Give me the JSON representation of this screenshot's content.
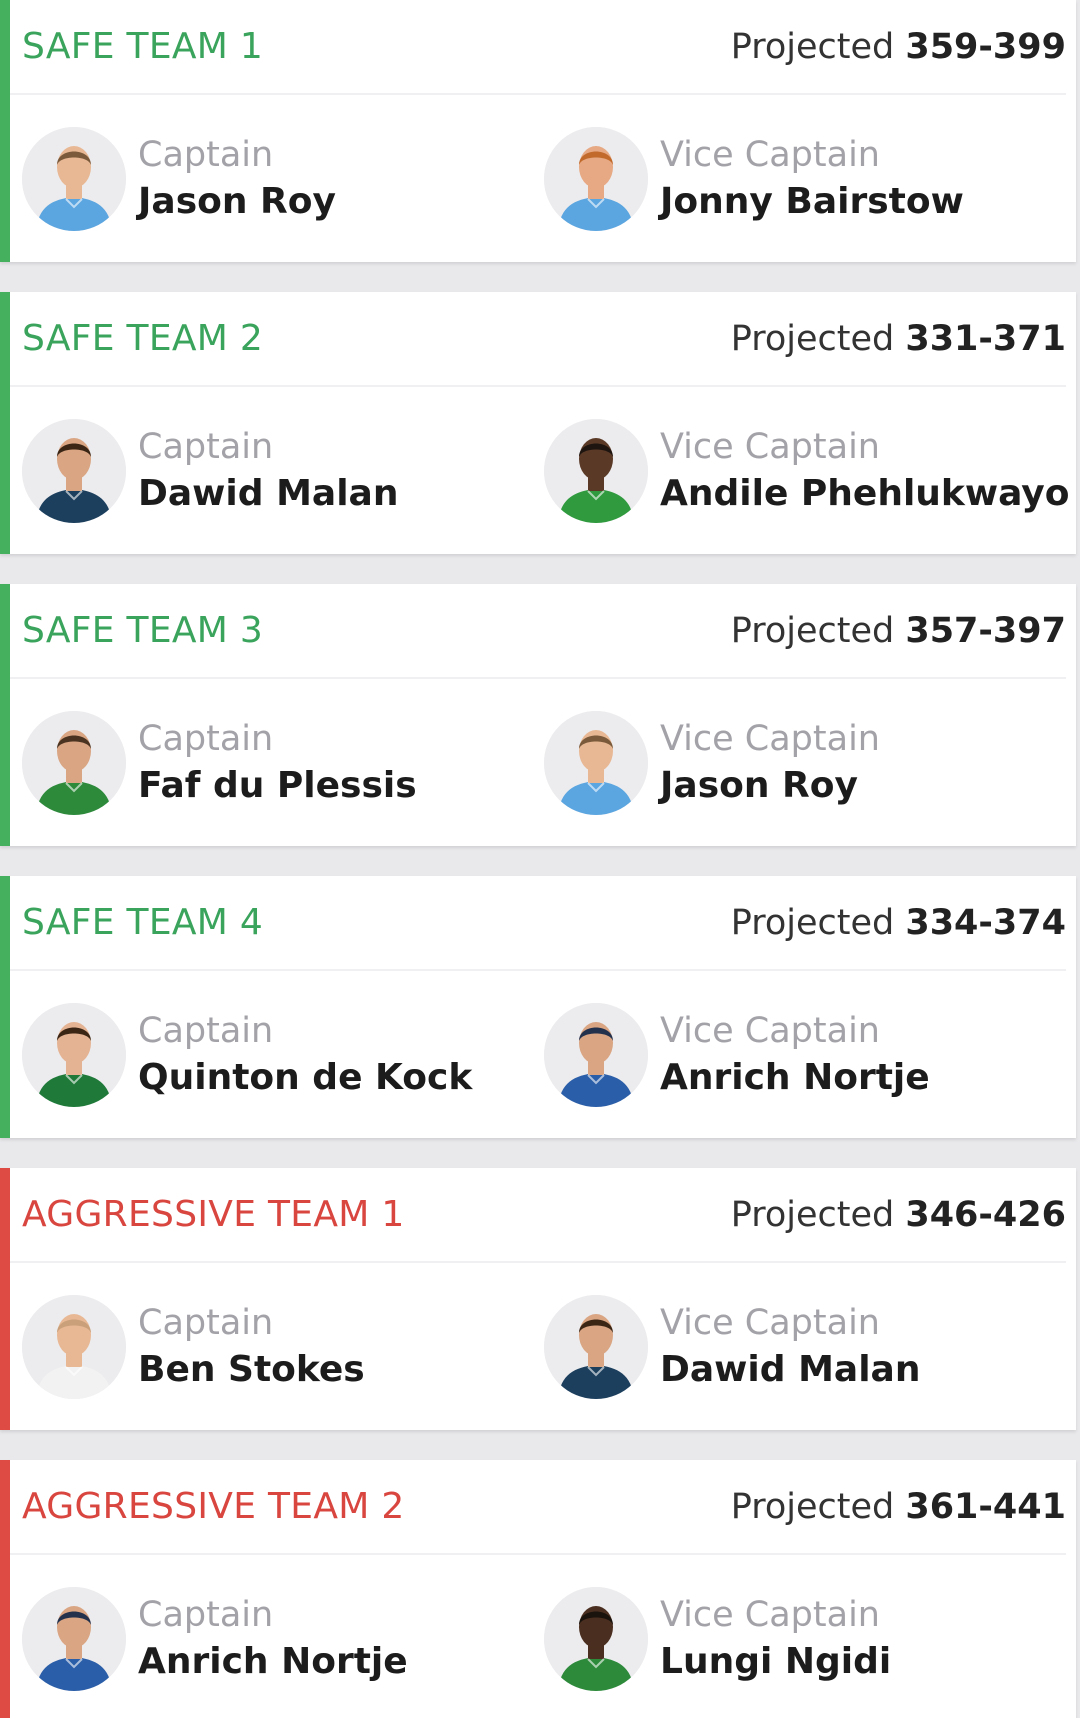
{
  "labels": {
    "projected": "Projected",
    "captain": "Captain",
    "vice_captain": "Vice Captain"
  },
  "colors": {
    "safe": "#3aa35c",
    "aggressive": "#d9453f",
    "safe_accent": "#45b15f",
    "aggressive_accent": "#dd4b44"
  },
  "teams": [
    {
      "name": "SAFE TEAM 1",
      "kind": "safe",
      "projected": "359-399",
      "captain": {
        "name": "Jason Roy",
        "jersey": "#5ba5e0",
        "skin": "#e8b894",
        "hair": "#7a5a3a",
        "icon": "player-avatar-icon"
      },
      "vice_captain": {
        "name": "Jonny Bairstow",
        "jersey": "#5ba5e0",
        "skin": "#e6a983",
        "hair": "#c26a2c",
        "icon": "player-avatar-icon"
      }
    },
    {
      "name": "SAFE TEAM 2",
      "kind": "safe",
      "projected": "331-371",
      "captain": {
        "name": "Dawid Malan",
        "jersey": "#1c3f5e",
        "skin": "#d9a583",
        "hair": "#3b2616",
        "icon": "player-avatar-icon"
      },
      "vice_captain": {
        "name": "Andile Phehlukwayo",
        "jersey": "#2f9a3e",
        "skin": "#5a3a27",
        "hair": "#1e1410",
        "icon": "player-avatar-icon"
      }
    },
    {
      "name": "SAFE TEAM 3",
      "kind": "safe",
      "projected": "357-397",
      "captain": {
        "name": "Faf du Plessis",
        "jersey": "#2d8a3b",
        "skin": "#d9a583",
        "hair": "#4a3320",
        "icon": "player-avatar-icon"
      },
      "vice_captain": {
        "name": "Jason Roy",
        "jersey": "#5ba5e0",
        "skin": "#e8b894",
        "hair": "#7a5a3a",
        "icon": "player-avatar-icon"
      }
    },
    {
      "name": "SAFE TEAM 4",
      "kind": "safe",
      "projected": "334-374",
      "captain": {
        "name": "Quinton de Kock",
        "jersey": "#1f7a3a",
        "skin": "#e4b393",
        "hair": "#3b2616",
        "icon": "player-avatar-icon"
      },
      "vice_captain": {
        "name": "Anrich Nortje",
        "jersey": "#2b5ea8",
        "skin": "#d9a583",
        "hair": "#24314d",
        "icon": "player-avatar-icon"
      }
    },
    {
      "name": "AGGRESSIVE TEAM 1",
      "kind": "aggressive",
      "projected": "346-426",
      "captain": {
        "name": "Ben Stokes",
        "jersey": "#f2f2f2",
        "skin": "#e8b894",
        "hair": "#c9a07a",
        "icon": "player-avatar-icon"
      },
      "vice_captain": {
        "name": "Dawid Malan",
        "jersey": "#1c3f5e",
        "skin": "#d9a583",
        "hair": "#3b2616",
        "icon": "player-avatar-icon"
      }
    },
    {
      "name": "AGGRESSIVE TEAM 2",
      "kind": "aggressive",
      "projected": "361-441",
      "captain": {
        "name": "Anrich Nortje",
        "jersey": "#2b5ea8",
        "skin": "#d9a583",
        "hair": "#24314d",
        "icon": "player-avatar-icon"
      },
      "vice_captain": {
        "name": "Lungi Ngidi",
        "jersey": "#2d8a3b",
        "skin": "#4a2e1f",
        "hair": "#1a120c",
        "icon": "player-avatar-icon"
      }
    }
  ]
}
